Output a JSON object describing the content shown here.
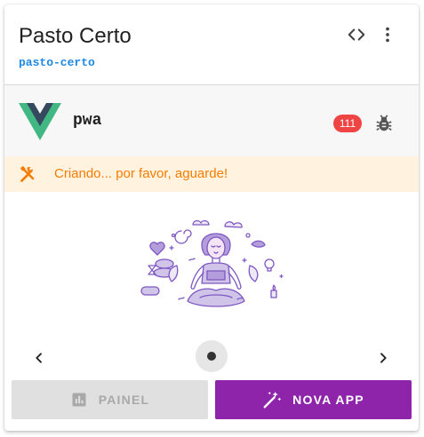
{
  "header": {
    "title": "Pasto Certo",
    "slug": "pasto-certo"
  },
  "project": {
    "name": "pwa",
    "badge_count": "111",
    "logo": "vue-logo-icon",
    "status_icon": "bug-icon"
  },
  "alert": {
    "text": "Criando... por favor, aguarde!",
    "icon": "tools-icon",
    "color": "#f57c00"
  },
  "carousel": {
    "illustration": "meditation-illustration",
    "active_index": 1,
    "total": 1
  },
  "actions": {
    "painel_label": "PAINEL",
    "nova_app_label": "NOVA APP",
    "painel_icon": "chart-icon",
    "nova_icon": "magic-wand-icon"
  },
  "colors": {
    "accent": "#8e24aa",
    "link": "#1e88e5",
    "badge": "#ef4444",
    "warning_bg": "#fff3e0"
  }
}
